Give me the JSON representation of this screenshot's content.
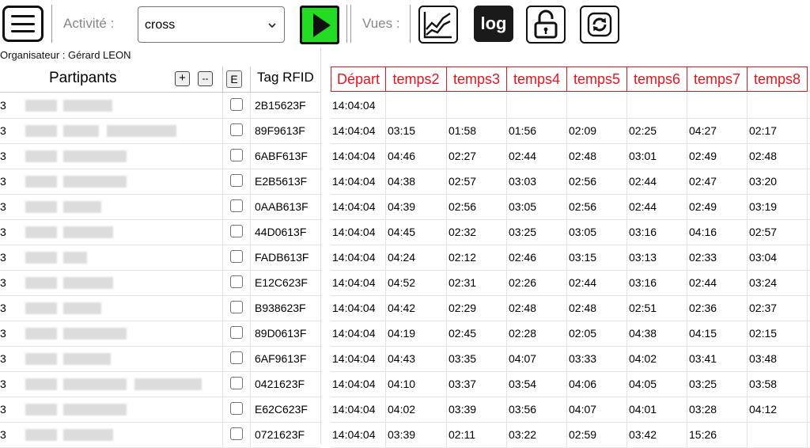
{
  "toolbar": {
    "activity_label": "Activité :",
    "activity_value": "cross",
    "views_label": "Vues :",
    "log_label": "log",
    "icons": {
      "menu": "hamburger-icon",
      "play": "play-icon",
      "chart": "line-chart-icon",
      "lock": "unlock-icon",
      "refresh": "refresh-icon"
    },
    "play_color": "#22dd22"
  },
  "organiser": "Organisateur : Gérard LEON",
  "left_table": {
    "title": "Partipants",
    "add_label": "+",
    "remove_label": "--",
    "e_label": "E",
    "tag_header": "Tag RFID",
    "rows": [
      {
        "prefix": "3",
        "tag": "2B15623F"
      },
      {
        "prefix": "3",
        "tag": "89F9613F"
      },
      {
        "prefix": "3",
        "tag": "6ABF613F"
      },
      {
        "prefix": "3",
        "tag": "E2B5613F"
      },
      {
        "prefix": "3",
        "tag": "0AAB613F"
      },
      {
        "prefix": "3",
        "tag": "44D0613F"
      },
      {
        "prefix": "3",
        "tag": "FADB613F"
      },
      {
        "prefix": "3",
        "tag": "E12C623F"
      },
      {
        "prefix": "3",
        "tag": "B938623F"
      },
      {
        "prefix": "3",
        "tag": "89D0613F"
      },
      {
        "prefix": "3",
        "tag": "6AF9613F"
      },
      {
        "prefix": "3",
        "tag": "0421623F"
      },
      {
        "prefix": "3",
        "tag": "E62C623F"
      },
      {
        "prefix": "3",
        "tag": "0721623F"
      }
    ]
  },
  "times_table": {
    "header_color": "#e8141d",
    "headers": [
      "Départ",
      "temps2",
      "temps3",
      "temps4",
      "temps5",
      "temps6",
      "temps7",
      "temps8"
    ],
    "rows": [
      [
        "14:04:04",
        "",
        "",
        "",
        "",
        "",
        "",
        ""
      ],
      [
        "14:04:04",
        "03:15",
        "01:58",
        "01:56",
        "02:09",
        "02:25",
        "04:27",
        "02:17"
      ],
      [
        "14:04:04",
        "04:46",
        "02:27",
        "02:44",
        "02:48",
        "03:01",
        "02:49",
        "02:48"
      ],
      [
        "14:04:04",
        "04:38",
        "02:57",
        "03:03",
        "02:56",
        "02:44",
        "02:47",
        "03:20"
      ],
      [
        "14:04:04",
        "04:39",
        "02:56",
        "03:05",
        "02:56",
        "02:44",
        "02:49",
        "03:19"
      ],
      [
        "14:04:04",
        "04:45",
        "02:32",
        "03:25",
        "03:05",
        "03:16",
        "04:16",
        "02:57"
      ],
      [
        "14:04:04",
        "04:24",
        "02:12",
        "02:46",
        "03:15",
        "03:13",
        "02:33",
        "03:04"
      ],
      [
        "14:04:04",
        "04:52",
        "02:31",
        "02:26",
        "02:44",
        "03:16",
        "02:44",
        "03:24"
      ],
      [
        "14:04:04",
        "04:42",
        "02:29",
        "02:48",
        "02:48",
        "02:51",
        "02:36",
        "02:37"
      ],
      [
        "14:04:04",
        "04:19",
        "02:45",
        "02:28",
        "02:05",
        "04:38",
        "04:15",
        "02:15"
      ],
      [
        "14:04:04",
        "04:43",
        "03:35",
        "04:07",
        "03:33",
        "04:02",
        "03:41",
        "03:48"
      ],
      [
        "14:04:04",
        "04:10",
        "03:37",
        "03:54",
        "04:06",
        "04:05",
        "03:25",
        "03:58"
      ],
      [
        "14:04:04",
        "04:02",
        "03:39",
        "03:56",
        "04:07",
        "04:01",
        "03:28",
        "04:12"
      ],
      [
        "14:04:04",
        "03:39",
        "02:11",
        "03:22",
        "02:59",
        "03:42",
        "15:26",
        ""
      ]
    ]
  }
}
